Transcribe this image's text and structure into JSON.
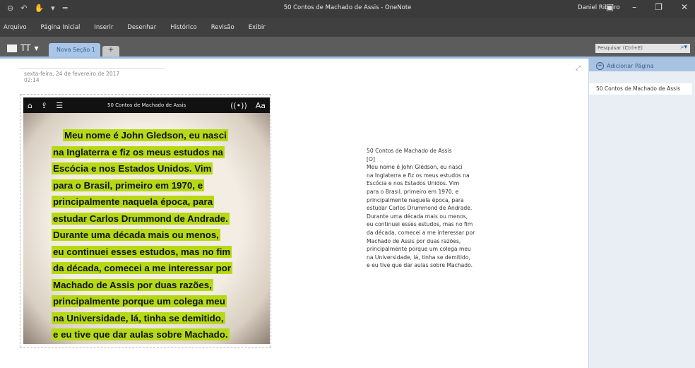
{
  "titlebar": {
    "title": "50 Contos de Machado de Assis - OneNote",
    "user": "Daniel Ribeiro",
    "qat": [
      "◀",
      "↶",
      "✋",
      "▾",
      "="
    ]
  },
  "menu": [
    "Arquivo",
    "Página Inicial",
    "Inserir",
    "Desenhar",
    "Histórico",
    "Revisão",
    "Exibir"
  ],
  "notebook": {
    "name": "TT",
    "section": "Nova Seção 1",
    "add": "+"
  },
  "search": {
    "placeholder": "Pesquisar (Ctrl+E)"
  },
  "page": {
    "date": "sexta-feira, 24 de fevereiro de 2017",
    "time": "02:14"
  },
  "panel": {
    "add_page": "Adicionar Página",
    "pages": [
      "50 Contos de Machado de Assis"
    ]
  },
  "image": {
    "title": "50 Contos de Machado de Assis",
    "font_btn": "Aa",
    "lines": [
      "Meu nome é John Gledson, eu nasci",
      "na Inglaterra e fiz os meus estudos na",
      "Escócia e nos Estados Unidos. Vim",
      "para o Brasil, primeiro em 1970, e",
      "principalmente naquela época, para",
      "estudar Carlos Drummond de Andrade.",
      "Durante uma década mais ou menos,",
      "eu continuei esses estudos, mas no fim",
      "da década, comecei a me interessar por",
      "Machado de Assis por duas razões,",
      "principalmente porque um colega meu",
      "na Universidade, lá, tinha se demitido,",
      "e eu tive que dar aulas sobre Machado."
    ]
  },
  "ocr": [
    "50 Contos de Machado de Assis",
    "[O]",
    "Meu nome é John Gledson, eu nasci",
    "na Inglaterra e fiz os meus estudos na",
    "Escócia e nos Estados Unidos. Vim",
    "para o Brasil, primeiro em 1970, e",
    "principalmente naquela época, para",
    "estudar Carlos Drummond de Andrade.",
    "Durante uma década mais ou menos,",
    "eu continuei esses estudos, mas no fim",
    "da década, comecei a me interessar por",
    "Machado de Assis por duas razões,",
    "principalmente porque um colega meu",
    "na Universidade, lá, tinha se demitido,",
    "e eu tive que dar aulas sobre Machado."
  ]
}
